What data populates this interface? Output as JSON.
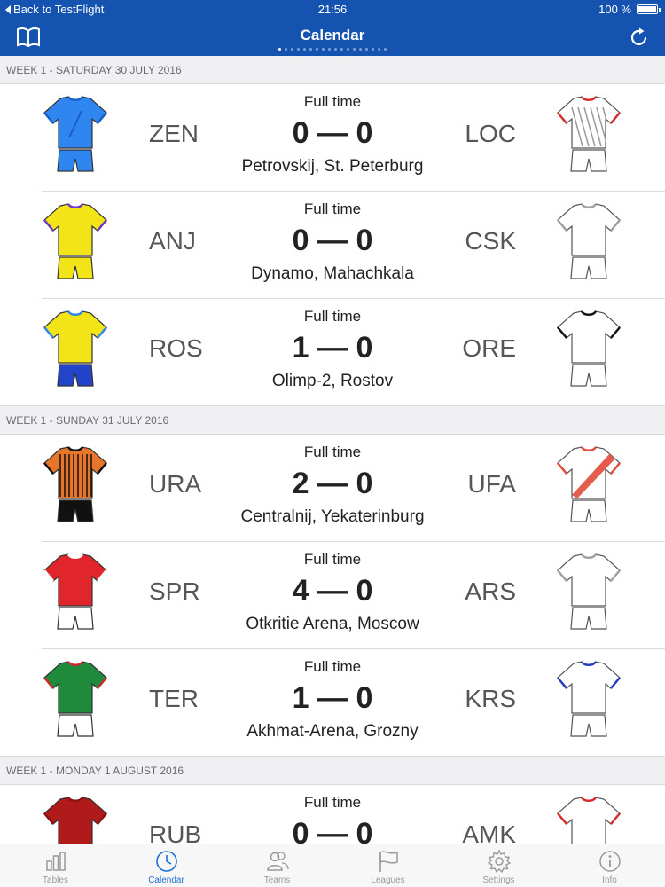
{
  "status_bar": {
    "back_label": "Back to TestFlight",
    "time": "21:56",
    "battery": "100 %"
  },
  "nav": {
    "title": "Calendar",
    "page_count": 18,
    "active_page": 0
  },
  "sections": [
    {
      "header": "WEEK 1 - SATURDAY 30 JULY 2016",
      "matches": [
        {
          "status": "Full time",
          "home": "ZEN",
          "away": "LOC",
          "score": "0 — 0",
          "venue": "Petrovskij, St. Peterburg",
          "home_kit": {
            "shirt": "#2f86f0",
            "shorts": "#2f86f0",
            "trim": "#1a5fc8",
            "pattern": "sash-blue"
          },
          "away_kit": {
            "shirt": "#ffffff",
            "shorts": "#ffffff",
            "trim": "#d52b2b",
            "pattern": "stripes-grey"
          }
        },
        {
          "status": "Full time",
          "home": "ANJ",
          "away": "CSK",
          "score": "0 — 0",
          "venue": "Dynamo, Mahachkala",
          "home_kit": {
            "shirt": "#f3e418",
            "shorts": "#f3e418",
            "trim": "#6a3bc4",
            "pattern": "plain"
          },
          "away_kit": {
            "shirt": "#ffffff",
            "shorts": "#ffffff",
            "trim": "#a0a0a0",
            "pattern": "plain"
          }
        },
        {
          "status": "Full time",
          "home": "ROS",
          "away": "ORE",
          "score": "1 — 0",
          "venue": "Olimp-2, Rostov",
          "home_kit": {
            "shirt": "#f3e418",
            "shorts": "#2144c8",
            "trim": "#2f86f0",
            "pattern": "plain"
          },
          "away_kit": {
            "shirt": "#ffffff",
            "shorts": "#ffffff",
            "trim": "#111111",
            "pattern": "plain"
          }
        }
      ]
    },
    {
      "header": "WEEK 1 - SUNDAY 31 JULY 2016",
      "matches": [
        {
          "status": "Full time",
          "home": "URA",
          "away": "UFA",
          "score": "2 — 0",
          "venue": "Centralnij, Yekaterinburg",
          "home_kit": {
            "shirt": "#e8762a",
            "shorts": "#111111",
            "trim": "#111111",
            "pattern": "stripes-orange"
          },
          "away_kit": {
            "shirt": "#ffffff",
            "shorts": "#ffffff",
            "trim": "#e04a3a",
            "pattern": "sash-red"
          }
        },
        {
          "status": "Full time",
          "home": "SPR",
          "away": "ARS",
          "score": "4 — 0",
          "venue": "Otkritie Arena, Moscow",
          "home_kit": {
            "shirt": "#e0262b",
            "shorts": "#ffffff",
            "trim": "#ffffff",
            "pattern": "plain"
          },
          "away_kit": {
            "shirt": "#ffffff",
            "shorts": "#ffffff",
            "trim": "#a0a0a0",
            "pattern": "plain"
          }
        },
        {
          "status": "Full time",
          "home": "TER",
          "away": "KRS",
          "score": "1 — 0",
          "venue": "Akhmat-Arena, Grozny",
          "home_kit": {
            "shirt": "#1f8a3b",
            "shorts": "#ffffff",
            "trim": "#c62b2b",
            "pattern": "plain"
          },
          "away_kit": {
            "shirt": "#ffffff",
            "shorts": "#ffffff",
            "trim": "#1f3fbf",
            "pattern": "plain"
          }
        }
      ]
    },
    {
      "header": "WEEK 1 - MONDAY 1 AUGUST 2016",
      "matches": [
        {
          "status": "Full time",
          "home": "RUB",
          "away": "AMK",
          "score": "0 — 0",
          "venue": "",
          "home_kit": {
            "shirt": "#b01a1a",
            "shorts": "#b01a1a",
            "trim": "#8a1212",
            "pattern": "plain"
          },
          "away_kit": {
            "shirt": "#ffffff",
            "shorts": "#ffffff",
            "trim": "#d52b2b",
            "pattern": "plain"
          }
        }
      ]
    }
  ],
  "tabs": [
    {
      "label": "Tables",
      "icon": "bar-chart-icon",
      "active": false
    },
    {
      "label": "Calendar",
      "icon": "clock-icon",
      "active": true
    },
    {
      "label": "Teams",
      "icon": "people-icon",
      "active": false
    },
    {
      "label": "Leagues",
      "icon": "flag-icon",
      "active": false
    },
    {
      "label": "Settings",
      "icon": "gear-icon",
      "active": false
    },
    {
      "label": "Info",
      "icon": "info-icon",
      "active": false
    }
  ],
  "colors": {
    "bar": "#1553b1",
    "accent": "#1e6fd9",
    "inactive": "#9a9a9a"
  }
}
